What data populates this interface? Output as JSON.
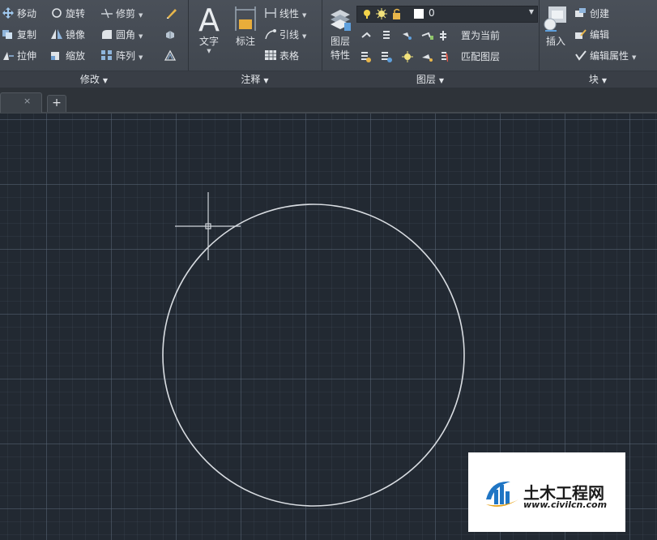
{
  "ribbon": {
    "modify": {
      "title": "修改",
      "tools": {
        "move": "移动",
        "rotate": "旋转",
        "trim": "修剪",
        "copy": "复制",
        "mirror": "镜像",
        "fillet": "圆角",
        "stretch": "拉伸",
        "scale": "缩放",
        "array": "阵列"
      }
    },
    "annotation": {
      "title": "注释",
      "text": "文字",
      "dimension": "标注",
      "linear": "线性",
      "leader": "引线",
      "table": "表格"
    },
    "layers": {
      "title": "图层",
      "properties_line1": "图层",
      "properties_line2": "特性",
      "current_layer": "0",
      "make_current": "置为当前",
      "match_layer": "匹配图层"
    },
    "block": {
      "title": "块",
      "insert": "插入",
      "create": "创建",
      "edit": "编辑",
      "edit_attributes": "编辑属性"
    }
  },
  "tabs": {
    "close_symbol": "×",
    "new_tab_symbol": "+"
  },
  "watermark": {
    "name": "土木工程网",
    "url": "www.civilcn.com"
  },
  "colors": {
    "ribbon_bg": "#444a52",
    "canvas_bg": "#222932",
    "circle": "#d9dde2",
    "crosshair": "#cfd4da"
  }
}
